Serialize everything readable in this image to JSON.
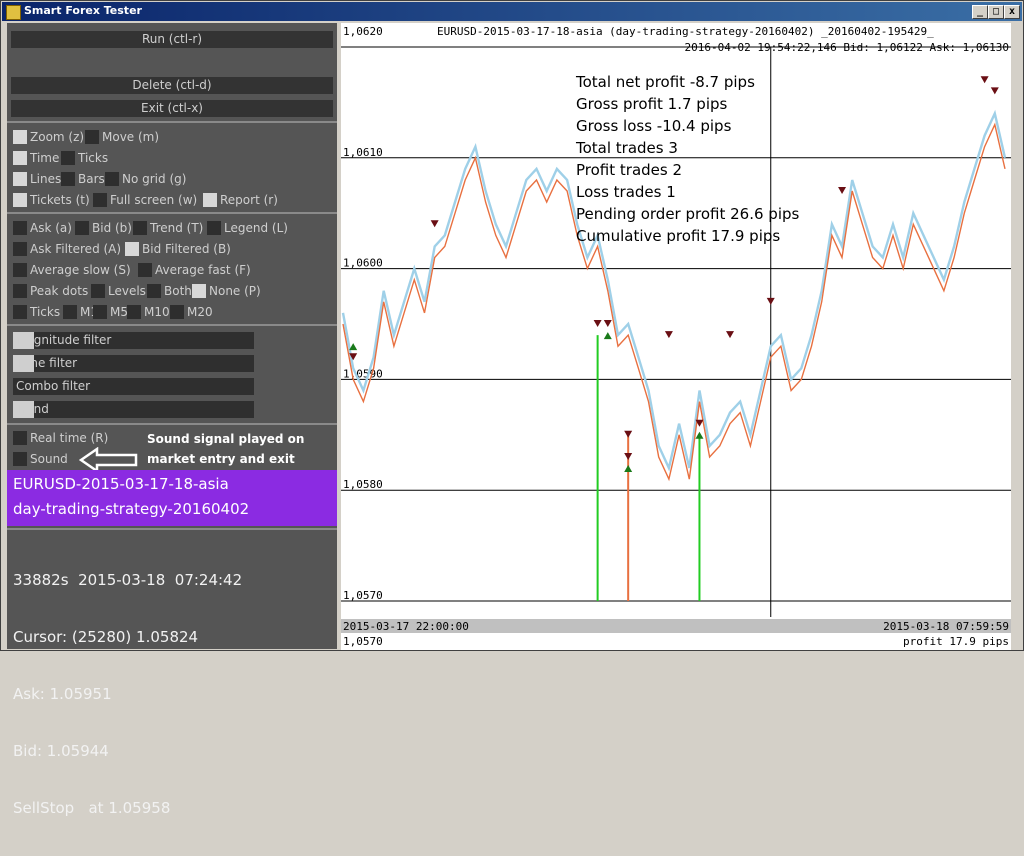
{
  "window": {
    "title": "Smart Forex Tester"
  },
  "buttons": {
    "run": "Run (ctl-r)",
    "delete": "Delete (ctl-d)",
    "exit": "Exit (ctl-x)"
  },
  "options": {
    "zoom": "Zoom (z)",
    "move": "Move (m)",
    "time": "Time",
    "ticks": "Ticks",
    "lines": "Lines",
    "bars": "Bars",
    "no_grid": "No grid (g)",
    "tickets": "Tickets (t)",
    "full_screen": "Full screen (w)",
    "report": "Report (r)",
    "ask": "Ask (a)",
    "bid": "Bid (b)",
    "trend": "Trend (T)",
    "legend": "Legend (L)",
    "ask_filtered": "Ask Filtered (A)",
    "bid_filtered": "Bid Filtered (B)",
    "average_slow": "Average slow (S)",
    "average_fast": "Average fast (F)",
    "peak_dots": "Peak dots",
    "levels": "Levels",
    "both": "Both",
    "none": "None (P)",
    "ticks2": "Ticks",
    "m1": "M1",
    "m5": "M5",
    "m10": "M10",
    "m20": "M20",
    "real_time": "Real time (R)",
    "sound": "Sound"
  },
  "filters": {
    "magnitude": "Magnitude filter",
    "time": "Time filter",
    "combo": "Combo filter",
    "trend": "Trend"
  },
  "annotation": {
    "line1": "Sound signal played on",
    "line2": "market entry and exit"
  },
  "info": {
    "line1": "EURUSD-2015-03-17-18-asia",
    "line2": "day-trading-strategy-20160402"
  },
  "status": {
    "line1": "33882s  2015-03-18  07:24:42",
    "line2": "Cursor: (25280) 1.05824",
    "line3": "Ask: 1.05951",
    "line4": "Bid: 1.05944",
    "line5": "SellStop   at 1.05958"
  },
  "chart_header": {
    "top_price": "1,0620",
    "title": "EURUSD-2015-03-17-18-asia (day-trading-strategy-20160402) _20160402-195429_",
    "sub": "2016-04-02 19:54:22,146 Bid: 1,06122 Ask: 1,06130"
  },
  "stats": {
    "net": "Total net profit -8.7 pips",
    "gross_profit": "Gross profit 1.7 pips",
    "gross_loss": "Gross loss -10.4 pips",
    "total_trades": "Total trades 3",
    "profit_trades": "Profit trades 2",
    "loss_trades": "Loss trades 1",
    "pending": "Pending order profit 26.6 pips",
    "cumulative": "Cumulative profit 17.9 pips"
  },
  "chart_footer": {
    "start": "2015-03-17 22:00:00",
    "end": "2015-03-18 07:59:59",
    "bottom_price": "1,0570",
    "profit": "profit 17.9 pips"
  },
  "chart_data": {
    "type": "line",
    "y_tick_labels": [
      "1,0610",
      "1,0600",
      "1,0590",
      "1,0580",
      "1,0570"
    ],
    "ylim": [
      1.057,
      1.062
    ],
    "series": [
      {
        "name": "",
        "color": "#9fd0e8",
        "values": [
          1.0596,
          1.0591,
          1.0589,
          1.0592,
          1.0598,
          1.0594,
          1.0597,
          1.06,
          1.0597,
          1.0602,
          1.0603,
          1.0606,
          1.0609,
          1.0611,
          1.0607,
          1.0604,
          1.0602,
          1.0605,
          1.0608,
          1.0609,
          1.0607,
          1.0609,
          1.0608,
          1.0604,
          1.0601,
          1.0603,
          1.0599,
          1.0594,
          1.0595,
          1.0592,
          1.0589,
          1.0584,
          1.0582,
          1.0586,
          1.0582,
          1.0589,
          1.0584,
          1.0585,
          1.0587,
          1.0588,
          1.0585,
          1.0589,
          1.0593,
          1.0594,
          1.059,
          1.0591,
          1.0594,
          1.0598,
          1.0604,
          1.0602,
          1.0608,
          1.0605,
          1.0602,
          1.0601,
          1.0604,
          1.0601,
          1.0605,
          1.0603,
          1.0601,
          1.0599,
          1.0602,
          1.0606,
          1.0609,
          1.0612,
          1.0614,
          1.061
        ]
      },
      {
        "name": "",
        "color": "#e87040",
        "values": [
          1.0595,
          1.059,
          1.0588,
          1.0591,
          1.0597,
          1.0593,
          1.0596,
          1.0599,
          1.0596,
          1.0601,
          1.0602,
          1.0605,
          1.0608,
          1.061,
          1.0606,
          1.0603,
          1.0601,
          1.0604,
          1.0607,
          1.0608,
          1.0606,
          1.0608,
          1.0607,
          1.0603,
          1.06,
          1.0602,
          1.0598,
          1.0593,
          1.0594,
          1.0591,
          1.0588,
          1.0583,
          1.0581,
          1.0585,
          1.0581,
          1.0588,
          1.0583,
          1.0584,
          1.0586,
          1.0587,
          1.0584,
          1.0588,
          1.0592,
          1.0593,
          1.0589,
          1.059,
          1.0593,
          1.0597,
          1.0603,
          1.0601,
          1.0607,
          1.0604,
          1.0601,
          1.06,
          1.0603,
          1.06,
          1.0604,
          1.0602,
          1.06,
          1.0598,
          1.0601,
          1.0605,
          1.0608,
          1.0611,
          1.0613,
          1.0609
        ]
      }
    ],
    "trade_lines": [
      {
        "index": 25,
        "price": 1.0594,
        "color": "#22cc22"
      },
      {
        "index": 28,
        "price": 1.0585,
        "color": "#e87040"
      },
      {
        "index": 35,
        "price": 1.0585,
        "color": "#22cc22"
      }
    ],
    "markers_down": [
      {
        "index": 1,
        "price": 1.0592
      },
      {
        "index": 9,
        "price": 1.0604
      },
      {
        "index": 25,
        "price": 1.0595
      },
      {
        "index": 26,
        "price": 1.0595
      },
      {
        "index": 28,
        "price": 1.0585
      },
      {
        "index": 28,
        "price": 1.0583
      },
      {
        "index": 32,
        "price": 1.0594
      },
      {
        "index": 35,
        "price": 1.0586
      },
      {
        "index": 38,
        "price": 1.0594
      },
      {
        "index": 42,
        "price": 1.0597
      },
      {
        "index": 49,
        "price": 1.0607
      },
      {
        "index": 63,
        "price": 1.0617
      },
      {
        "index": 64,
        "price": 1.0616
      }
    ],
    "markers_up": [
      {
        "index": 1,
        "price": 1.0593
      },
      {
        "index": 26,
        "price": 1.0594
      },
      {
        "index": 28,
        "price": 1.0582
      },
      {
        "index": 35,
        "price": 1.0585
      }
    ],
    "cursor_index": 42
  }
}
